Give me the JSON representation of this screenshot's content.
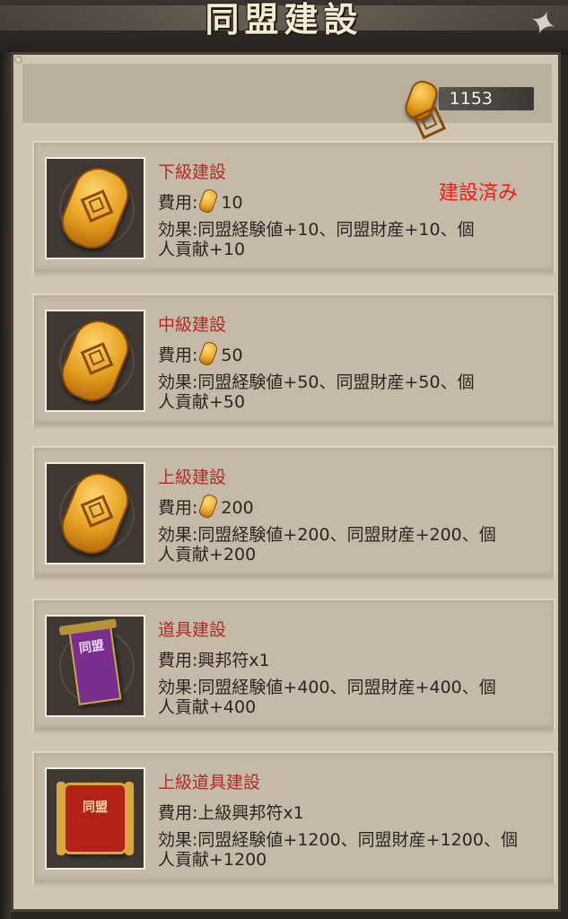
{
  "header": {
    "title": "同盟建設"
  },
  "currency": {
    "icon": "koban-coin-icon",
    "value": "1153"
  },
  "cards": [
    {
      "title": "下級建設",
      "cost_label": "費用:",
      "cost_icon": "koban-coin-icon",
      "cost_value": "10",
      "effect_line1": "効果:同盟経験値+10、同盟財産+10、個",
      "effect_line2": "人貢献+10",
      "status": "建設済み"
    },
    {
      "title": "中級建設",
      "cost_label": "費用:",
      "cost_icon": "koban-coin-icon",
      "cost_value": "50",
      "effect_line1": "効果:同盟経験値+50、同盟財産+50、個",
      "effect_line2": "人貢献+50"
    },
    {
      "title": "上級建設",
      "cost_label": "費用:",
      "cost_icon": "koban-coin-icon",
      "cost_value": "200",
      "effect_line1": "効果:同盟経験値+200、同盟財産+200、個",
      "effect_line2": "人貢献+200"
    },
    {
      "title": "道具建設",
      "cost_label": "費用:",
      "cost_value": "興邦符x1",
      "effect_line1": "効果:同盟経験値+400、同盟財産+400、個",
      "effect_line2": "人貢献+400",
      "icon_text": "同盟"
    },
    {
      "title": "上級道具建設",
      "cost_label": "費用:",
      "cost_value": "上級興邦符x1",
      "effect_line1": "効果:同盟経験値+1200、同盟財産+1200、個",
      "effect_line2": "人貢献+1200",
      "icon_text": "同盟"
    }
  ],
  "colors": {
    "title_red": "#b22a24",
    "status_red": "#ee1d1d",
    "panel": "#cfc6b4",
    "card": "#c4baa7"
  }
}
